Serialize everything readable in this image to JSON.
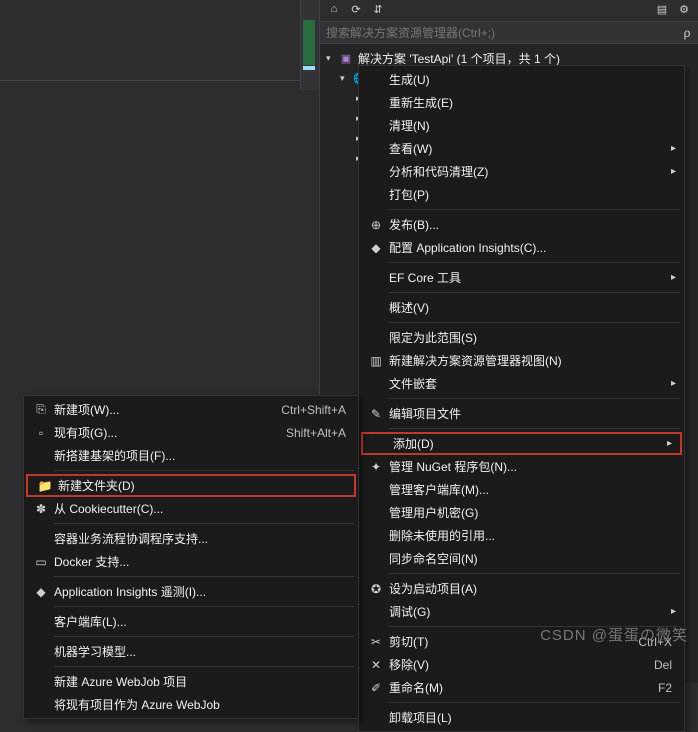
{
  "solutionExplorer": {
    "searchPlaceholder": "搜索解决方案资源管理器(Ctrl+;)",
    "searchSymbol": "ρ",
    "solutionLine": "解决方案 'TestApi' (1 个项目，共 1 个)"
  },
  "contextMenu": {
    "items": [
      {
        "label": "生成(U)"
      },
      {
        "label": "重新生成(E)"
      },
      {
        "label": "清理(N)"
      },
      {
        "label": "查看(W)",
        "arrow": true
      },
      {
        "label": "分析和代码清理(Z)",
        "arrow": true
      },
      {
        "label": "打包(P)"
      },
      {
        "sep": true
      },
      {
        "label": "发布(B)...",
        "icon": "publish-icon",
        "glyph": "⊕"
      },
      {
        "label": "配置 Application Insights(C)...",
        "icon": "insights-icon",
        "glyph": "◆",
        "purple": true
      },
      {
        "sep": true
      },
      {
        "label": "EF Core 工具",
        "arrow": true
      },
      {
        "sep": true
      },
      {
        "label": "概述(V)"
      },
      {
        "sep": true
      },
      {
        "label": "限定为此范围(S)"
      },
      {
        "label": "新建解决方案资源管理器视图(N)",
        "icon": "new-view-icon",
        "glyph": "▥"
      },
      {
        "label": "文件嵌套",
        "arrow": true
      },
      {
        "sep": true
      },
      {
        "label": "编辑项目文件",
        "icon": "edit-icon",
        "glyph": "✎"
      },
      {
        "sep": true
      },
      {
        "label": "添加(D)",
        "arrow": true,
        "highlight": true
      },
      {
        "label": "管理 NuGet 程序包(N)...",
        "icon": "nuget-icon",
        "glyph": "✦",
        "blue": true
      },
      {
        "label": "管理客户端库(M)..."
      },
      {
        "label": "管理用户机密(G)"
      },
      {
        "label": "删除未使用的引用..."
      },
      {
        "label": "同步命名空间(N)"
      },
      {
        "sep": true
      },
      {
        "label": "设为启动项目(A)",
        "icon": "startup-icon",
        "glyph": "✪"
      },
      {
        "label": "调试(G)",
        "arrow": true
      },
      {
        "sep": true
      },
      {
        "label": "剪切(T)",
        "icon": "cut-icon",
        "glyph": "✂",
        "shortcut": "Ctrl+X"
      },
      {
        "label": "移除(V)",
        "icon": "remove-icon",
        "glyph": "✕",
        "shortcut": "Del"
      },
      {
        "label": "重命名(M)",
        "icon": "rename-icon",
        "glyph": "✐",
        "shortcut": "F2"
      },
      {
        "sep": true
      },
      {
        "label": "卸载项目(L)"
      }
    ]
  },
  "addSubmenu": {
    "items": [
      {
        "label": "新建项(W)...",
        "icon": "new-item-icon",
        "glyph": "⎘",
        "shortcut": "Ctrl+Shift+A"
      },
      {
        "label": "现有项(G)...",
        "icon": "existing-item-icon",
        "glyph": "▫",
        "shortcut": "Shift+Alt+A"
      },
      {
        "label": "新搭建基架的项目(F)..."
      },
      {
        "sep": true
      },
      {
        "label": "新建文件夹(D)",
        "icon": "new-folder-icon",
        "glyph": "📁",
        "highlight": true
      },
      {
        "label": "从 Cookiecutter(C)...",
        "icon": "cookie-icon",
        "glyph": "✽",
        "green": true
      },
      {
        "sep": true
      },
      {
        "label": "容器业务流程协调程序支持..."
      },
      {
        "label": "Docker 支持...",
        "icon": "docker-icon",
        "glyph": "▭",
        "blue": true
      },
      {
        "sep": true
      },
      {
        "label": "Application Insights 遥测(I)...",
        "icon": "telemetry-icon",
        "glyph": "◆",
        "purple": true
      },
      {
        "sep": true
      },
      {
        "label": "客户端库(L)..."
      },
      {
        "sep": true
      },
      {
        "label": "机器学习模型..."
      },
      {
        "sep": true
      },
      {
        "label": "新建 Azure WebJob 项目"
      },
      {
        "label": "将现有项目作为 Azure WebJob"
      }
    ]
  },
  "watermark": "CSDN @蛋蛋の微笑"
}
